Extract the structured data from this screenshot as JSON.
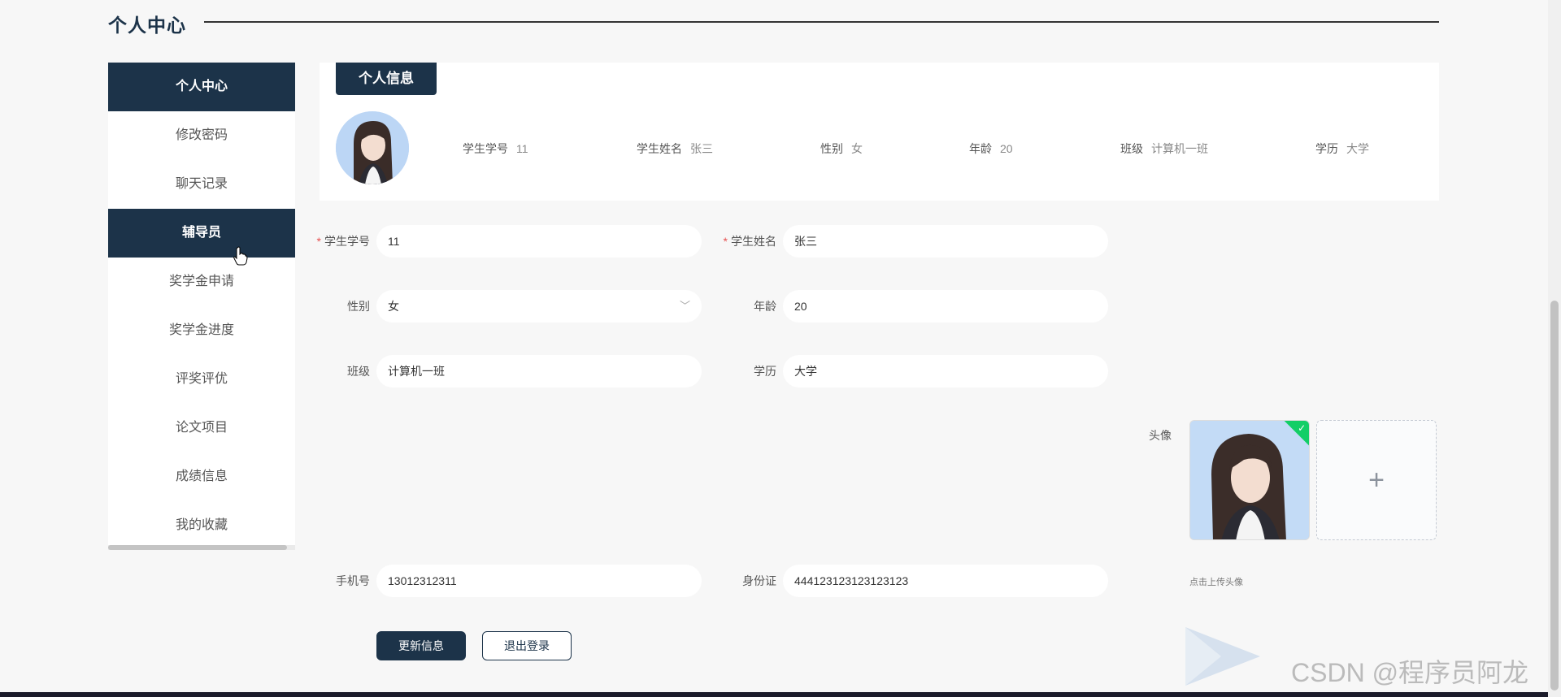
{
  "page": {
    "title": "个人中心"
  },
  "sidebar": {
    "items": [
      {
        "label": "个人中心",
        "active": true
      },
      {
        "label": "修改密码",
        "active": false
      },
      {
        "label": "聊天记录",
        "active": false
      },
      {
        "label": "辅导员",
        "active": true
      },
      {
        "label": "奖学金申请",
        "active": false
      },
      {
        "label": "奖学金进度",
        "active": false
      },
      {
        "label": "评奖评优",
        "active": false
      },
      {
        "label": "论文项目",
        "active": false
      },
      {
        "label": "成绩信息",
        "active": false
      },
      {
        "label": "我的收藏",
        "active": false
      }
    ]
  },
  "info_card": {
    "tab_label": "个人信息",
    "fields": [
      {
        "label": "学生学号",
        "value": "11"
      },
      {
        "label": "学生姓名",
        "value": "张三"
      },
      {
        "label": "性别",
        "value": "女"
      },
      {
        "label": "年龄",
        "value": "20"
      },
      {
        "label": "班级",
        "value": "计算机一班"
      },
      {
        "label": "学历",
        "value": "大学"
      }
    ]
  },
  "form": {
    "student_id": {
      "label": "学生学号",
      "value": "11",
      "required": true
    },
    "student_name": {
      "label": "学生姓名",
      "value": "张三",
      "required": true
    },
    "gender": {
      "label": "性别",
      "value": "女"
    },
    "age": {
      "label": "年龄",
      "value": "20"
    },
    "class": {
      "label": "班级",
      "value": "计算机一班"
    },
    "education": {
      "label": "学历",
      "value": "大学"
    },
    "avatar": {
      "label": "头像",
      "tip": "点击上传头像"
    },
    "phone": {
      "label": "手机号",
      "value": "13012312311"
    },
    "id_card": {
      "label": "身份证",
      "value": "444123123123123123"
    },
    "required_mark": "*",
    "chevron_glyph": "﹀",
    "plus_glyph": "+",
    "check_glyph": "✓"
  },
  "buttons": {
    "update": "更新信息",
    "logout": "退出登录"
  },
  "watermark": {
    "text": "CSDN @程序员阿龙"
  },
  "colors": {
    "primary": "#1c3349",
    "required": "#e65353",
    "success": "#13ce66"
  },
  "icons": {
    "cursor": "hand-pointer-icon",
    "upload": "plus-icon",
    "uploaded": "check-icon",
    "select": "chevron-down-icon"
  }
}
